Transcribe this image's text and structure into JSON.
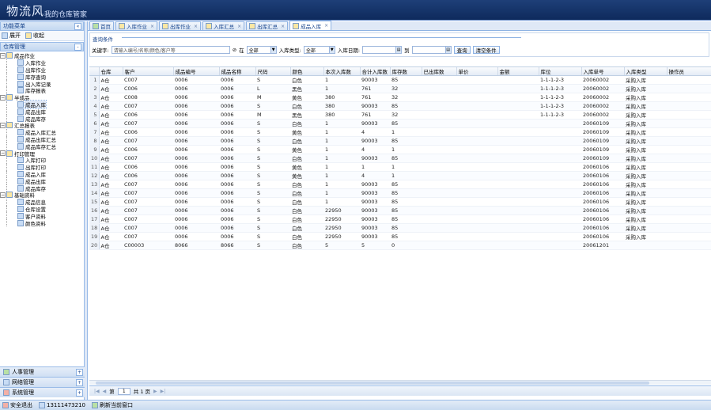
{
  "header": {
    "logo": "物流风",
    "slogan": "我的仓库管家"
  },
  "left": {
    "title": "功能菜单",
    "toolbar": [
      {
        "label": "展开",
        "icon": "expand-icon"
      },
      {
        "label": "收起",
        "icon": "collapse-icon"
      }
    ],
    "section": "仓库管理",
    "tree": [
      {
        "label": "成品作业",
        "level": 0,
        "type": "group"
      },
      {
        "label": "入库作业",
        "level": 1
      },
      {
        "label": "出库作业",
        "level": 1
      },
      {
        "label": "库存查询",
        "level": 1
      },
      {
        "label": "出入库记录",
        "level": 1
      },
      {
        "label": "库存报表",
        "level": 1
      },
      {
        "label": "半成品",
        "level": 0,
        "type": "group"
      },
      {
        "label": "成品入库",
        "level": 1,
        "selected": true
      },
      {
        "label": "成品出库",
        "level": 1
      },
      {
        "label": "成品库存",
        "level": 1
      },
      {
        "label": "汇总报表",
        "level": 0,
        "type": "group"
      },
      {
        "label": "成品入库汇总",
        "level": 1
      },
      {
        "label": "成品出库汇总",
        "level": 1
      },
      {
        "label": "成品库存汇总",
        "level": 1
      },
      {
        "label": "打印管理",
        "level": 0,
        "type": "group"
      },
      {
        "label": "入库打印",
        "level": 1
      },
      {
        "label": "出库打印",
        "level": 1
      },
      {
        "label": "成品入库",
        "level": 1
      },
      {
        "label": "成品出库",
        "level": 1
      },
      {
        "label": "成品库存",
        "level": 1
      },
      {
        "label": "基础资料",
        "level": 0,
        "type": "group"
      },
      {
        "label": "成品信息",
        "level": 1
      },
      {
        "label": "仓库设置",
        "level": 1
      },
      {
        "label": "客户资料",
        "level": 1
      },
      {
        "label": "颜色资料",
        "level": 1
      }
    ],
    "accordion": [
      "人事管理",
      "网络管理",
      "系统管理"
    ]
  },
  "tabs": [
    {
      "label": "首页",
      "closable": false
    },
    {
      "label": "入库作业",
      "closable": true
    },
    {
      "label": "出库作业",
      "closable": true
    },
    {
      "label": "入库汇总",
      "closable": true
    },
    {
      "label": "出库汇总",
      "closable": true
    },
    {
      "label": "成品入库",
      "closable": true,
      "active": true
    }
  ],
  "query": {
    "legend": "查询条件",
    "keyword_label": "关键字:",
    "keyword_placeholder": "请输入编号/名称/颜色/客户等",
    "at_label": "在",
    "field_value": "全部",
    "type_label": "入库类型:",
    "type_value": "全部",
    "date_label": "入库日期:",
    "to_label": "到",
    "search_btn": "查询",
    "reset_btn": "清空条件"
  },
  "grid": {
    "columns": [
      "仓库",
      "客户",
      "成品编号",
      "成品名称",
      "尺码",
      "颜色",
      "本次入库数",
      "合计入库数",
      "库存数",
      "已出库数",
      "单价",
      "金额",
      "库位",
      "入库单号",
      "入库类型",
      "操作员"
    ],
    "rows": [
      [
        "A仓",
        "C007",
        "0006",
        "0006",
        "S",
        "白色",
        "1",
        "90003",
        "85",
        "",
        "",
        "",
        "1-1-1-2-3",
        "20060002",
        "采购入库",
        ""
      ],
      [
        "A仓",
        "C006",
        "0006",
        "0006",
        "L",
        "黑色",
        "1",
        "761",
        "32",
        "",
        "",
        "",
        "1-1-1-2-3",
        "20060002",
        "采购入库",
        ""
      ],
      [
        "A仓",
        "C008",
        "0006",
        "0006",
        "M",
        "黄色",
        "380",
        "761",
        "32",
        "",
        "",
        "",
        "1-1-1-2-3",
        "20060002",
        "采购入库",
        ""
      ],
      [
        "A仓",
        "C007",
        "0006",
        "0006",
        "S",
        "白色",
        "380",
        "90003",
        "85",
        "",
        "",
        "",
        "1-1-1-2-3",
        "20060002",
        "采购入库",
        ""
      ],
      [
        "A仓",
        "C006",
        "0006",
        "0006",
        "M",
        "黑色",
        "380",
        "761",
        "32",
        "",
        "",
        "",
        "1-1-1-2-3",
        "20060002",
        "采购入库",
        ""
      ],
      [
        "A仓",
        "C007",
        "0006",
        "0006",
        "S",
        "白色",
        "1",
        "90003",
        "85",
        "",
        "",
        "",
        "",
        "20060109",
        "采购入库",
        ""
      ],
      [
        "A仓",
        "C006",
        "0006",
        "0006",
        "S",
        "黄色",
        "1",
        "4",
        "1",
        "",
        "",
        "",
        "",
        "20060109",
        "采购入库",
        ""
      ],
      [
        "A仓",
        "C007",
        "0006",
        "0006",
        "S",
        "白色",
        "1",
        "90003",
        "85",
        "",
        "",
        "",
        "",
        "20060109",
        "采购入库",
        ""
      ],
      [
        "A仓",
        "C006",
        "0006",
        "0006",
        "S",
        "黄色",
        "1",
        "4",
        "1",
        "",
        "",
        "",
        "",
        "20060109",
        "采购入库",
        ""
      ],
      [
        "A仓",
        "C007",
        "0006",
        "0006",
        "S",
        "白色",
        "1",
        "90003",
        "85",
        "",
        "",
        "",
        "",
        "20060109",
        "采购入库",
        ""
      ],
      [
        "A仓",
        "C006",
        "0006",
        "0006",
        "S",
        "黄色",
        "1",
        "1",
        "1",
        "",
        "",
        "",
        "",
        "20060106",
        "采购入库",
        ""
      ],
      [
        "A仓",
        "C006",
        "0006",
        "0006",
        "S",
        "黄色",
        "1",
        "4",
        "1",
        "",
        "",
        "",
        "",
        "20060106",
        "采购入库",
        ""
      ],
      [
        "A仓",
        "C007",
        "0006",
        "0006",
        "S",
        "白色",
        "1",
        "90003",
        "85",
        "",
        "",
        "",
        "",
        "20060106",
        "采购入库",
        ""
      ],
      [
        "A仓",
        "C007",
        "0006",
        "0006",
        "S",
        "白色",
        "1",
        "90003",
        "85",
        "",
        "",
        "",
        "",
        "20060106",
        "采购入库",
        ""
      ],
      [
        "A仓",
        "C007",
        "0006",
        "0006",
        "S",
        "白色",
        "1",
        "90003",
        "85",
        "",
        "",
        "",
        "",
        "20060106",
        "采购入库",
        ""
      ],
      [
        "A仓",
        "C007",
        "0006",
        "0006",
        "S",
        "白色",
        "22950",
        "90003",
        "85",
        "",
        "",
        "",
        "",
        "20060106",
        "采购入库",
        ""
      ],
      [
        "A仓",
        "C007",
        "0006",
        "0006",
        "S",
        "白色",
        "22950",
        "90003",
        "85",
        "",
        "",
        "",
        "",
        "20060106",
        "采购入库",
        ""
      ],
      [
        "A仓",
        "C007",
        "0006",
        "0006",
        "S",
        "白色",
        "22950",
        "90003",
        "85",
        "",
        "",
        "",
        "",
        "20060106",
        "采购入库",
        ""
      ],
      [
        "A仓",
        "C007",
        "0006",
        "0006",
        "S",
        "白色",
        "22950",
        "90003",
        "85",
        "",
        "",
        "",
        "",
        "20060106",
        "采购入库",
        ""
      ],
      [
        "A仓",
        "C00003",
        "8066",
        "8066",
        "S",
        "白色",
        "5",
        "5",
        "0",
        "",
        "",
        "",
        "",
        "20061201",
        "",
        ""
      ]
    ]
  },
  "paging": {
    "page_label": "第",
    "page_value": "1",
    "total_label": "共 1 页"
  },
  "status": [
    {
      "label": "安全退出",
      "icon": "exit-icon"
    },
    {
      "label": "13111473210",
      "icon": "user-icon"
    },
    {
      "label": "刷新当前窗口",
      "icon": "refresh-icon"
    }
  ]
}
